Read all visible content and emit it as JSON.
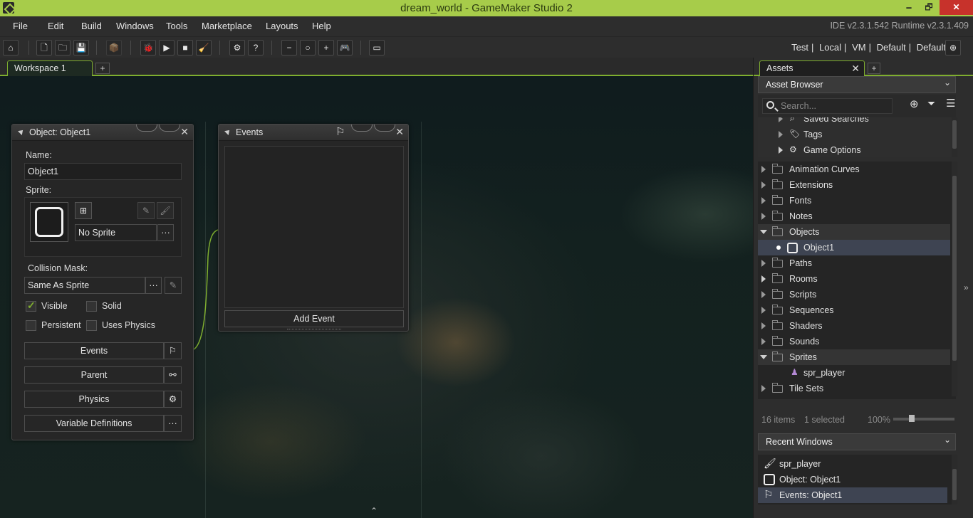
{
  "window": {
    "title": "dream_world - GameMaker Studio 2",
    "controls": {
      "minimize": "🗕",
      "restore": "🗗",
      "close": "✕"
    }
  },
  "menu": {
    "items": [
      "File",
      "Edit",
      "Build",
      "Windows",
      "Tools",
      "Marketplace",
      "Layouts",
      "Help"
    ],
    "version": "IDE v2.3.1.542  Runtime v2.3.1.409"
  },
  "toolbar": {
    "targets": [
      "Test",
      "Local",
      "VM",
      "Default",
      "Default"
    ],
    "separator": "|",
    "icons": {
      "home": "⌂",
      "new": "🗋",
      "open": "🗀",
      "save": "💾",
      "package": "📦",
      "debug": "🐞",
      "run": "▶",
      "stop": "■",
      "clean": "🧹",
      "preferences": "⚙",
      "help": "?",
      "zoom_out": "−",
      "zoom_reset": "○",
      "zoom_in": "+",
      "game_options": "🎮",
      "fullscreen": "▭",
      "target": "⊕"
    }
  },
  "workspace": {
    "tab_label": "Workspace 1",
    "add_tab": "+"
  },
  "object_panel": {
    "title": "Object: Object1",
    "name_label": "Name:",
    "name_value": "Object1",
    "sprite_label": "Sprite:",
    "sprite_value": "No Sprite",
    "more": "···",
    "collision_label": "Collision Mask:",
    "collision_value": "Same As Sprite",
    "checkboxes": {
      "visible": {
        "label": "Visible",
        "checked": true
      },
      "solid": {
        "label": "Solid",
        "checked": false
      },
      "persistent": {
        "label": "Persistent",
        "checked": false
      },
      "uses_physics": {
        "label": "Uses Physics",
        "checked": false
      }
    },
    "buttons": {
      "events": "Events",
      "parent": "Parent",
      "physics": "Physics",
      "variable_definitions": "Variable Definitions"
    },
    "close": "✕"
  },
  "events_panel": {
    "title": "Events",
    "add_event": "Add Event",
    "close": "✕"
  },
  "assets": {
    "tab_label": "Assets",
    "tab_close": "✕",
    "add_tab": "+",
    "browser_label": "Asset Browser",
    "search_placeholder": "Search...",
    "tree_top": [
      {
        "label": "Saved Searches"
      },
      {
        "label": "Tags"
      },
      {
        "label": "Game Options"
      }
    ],
    "tree": [
      {
        "label": "Animation Curves",
        "expanded": false,
        "filled": false
      },
      {
        "label": "Extensions",
        "expanded": false,
        "filled": false
      },
      {
        "label": "Fonts",
        "expanded": false,
        "filled": false
      },
      {
        "label": "Notes",
        "expanded": false,
        "filled": false
      },
      {
        "label": "Objects",
        "expanded": true,
        "filled": true
      },
      {
        "label": "Object1",
        "child": true,
        "selected": true
      },
      {
        "label": "Paths",
        "expanded": false,
        "filled": false
      },
      {
        "label": "Rooms",
        "expanded": false,
        "filled": true
      },
      {
        "label": "Scripts",
        "expanded": false,
        "filled": false
      },
      {
        "label": "Sequences",
        "expanded": false,
        "filled": false
      },
      {
        "label": "Shaders",
        "expanded": false,
        "filled": false
      },
      {
        "label": "Sounds",
        "expanded": false,
        "filled": false
      },
      {
        "label": "Sprites",
        "expanded": true,
        "filled": true
      },
      {
        "label": "spr_player",
        "child": true,
        "selected": false
      },
      {
        "label": "Tile Sets",
        "expanded": false,
        "filled": false
      }
    ],
    "status_items": "16 items",
    "status_selected": "1 selected",
    "zoom": "100%"
  },
  "recent_windows": {
    "label": "Recent Windows",
    "items": [
      {
        "label": "spr_player",
        "icon": "brush-icon"
      },
      {
        "label": "Object: Object1",
        "icon": "object-icon"
      },
      {
        "label": "Events: Object1",
        "icon": "flag-icon"
      }
    ]
  },
  "colors": {
    "accent": "#7fae2f",
    "titlebar": "#a7cc4a",
    "selection": "#3e4452"
  }
}
